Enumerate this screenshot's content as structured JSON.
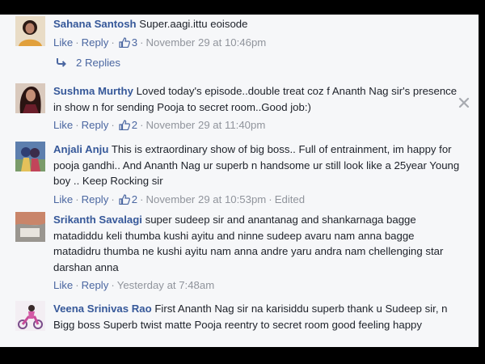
{
  "comments": [
    {
      "author": "Sahana Santosh",
      "text": "Super.aagi.ittu eoisode",
      "actions": {
        "like": "Like",
        "reply": "Reply",
        "likes": "3",
        "time": "November 29 at 10:46pm"
      },
      "replies_label": "2 Replies"
    },
    {
      "author": "Sushma Murthy",
      "text": "Loved today's episode..double treat coz f Ananth Nag sir's presence in show n for sending Pooja to secret room..Good job:)",
      "actions": {
        "like": "Like",
        "reply": "Reply",
        "likes": "2",
        "time": "November 29 at 11:40pm"
      }
    },
    {
      "author": "Anjali Anju",
      "text": "This is extraordinary show of big boss.. Full of entrainment, im happy for pooja gandhi.. And Ananth Nag ur superb n handsome ur still look like a 25year Young boy .. Keep Rocking sir",
      "actions": {
        "like": "Like",
        "reply": "Reply",
        "likes": "2",
        "time": "November 29 at 10:53pm",
        "edited": "Edited"
      }
    },
    {
      "author": "Srikanth Savalagi",
      "text": "super sudeep sir and anantanag and shankarnaga bagge matadiddu keli thumba kushi ayitu and ninne sudeep avaru nam anna bagge matadidru thumba ne kushi ayitu nam anna andre yaru andra nam chellenging star darshan anna",
      "actions": {
        "like": "Like",
        "reply": "Reply",
        "time": "Yesterday at 7:48am"
      }
    },
    {
      "author": "Veena Srinivas Rao",
      "text": "First Ananth Nag sir na karisiddu superb thank u Sudeep sir, n Bigg boss Superb twist matte Pooja reentry to secret room good feeling happy"
    }
  ],
  "icons": {
    "thumbs_up": "thumbs-up-icon",
    "reply_arrow": "reply-arrow-icon",
    "close": "close-icon"
  },
  "colors": {
    "author": "#365899",
    "link": "#4b67a1",
    "meta": "#90949c",
    "text": "#1d2129",
    "background": "#f6f7f9"
  }
}
